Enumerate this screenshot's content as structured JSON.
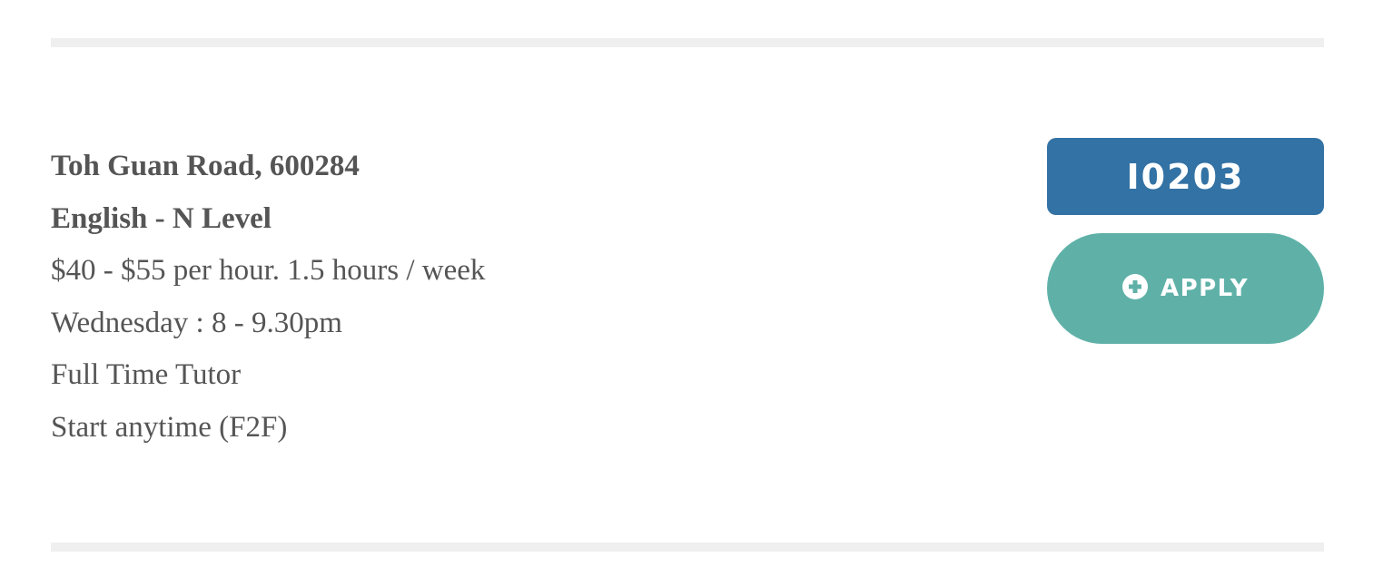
{
  "listing": {
    "location": "Toh Guan Road, 600284",
    "subject": "English - N Level",
    "rate": "$40 - $55 per hour. 1.5 hours / week",
    "schedule": "Wednesday : 8 - 9.30pm",
    "tutor_type": "Full Time Tutor",
    "start": "Start anytime (F2F)",
    "job_id": "I0203",
    "apply_label": "APPLY",
    "apply_icon": "plus-circle-icon"
  },
  "colors": {
    "text": "#555555",
    "job_id_bg": "#3372a4",
    "apply_bg": "#5fb1a8",
    "divider": "#efefef"
  }
}
